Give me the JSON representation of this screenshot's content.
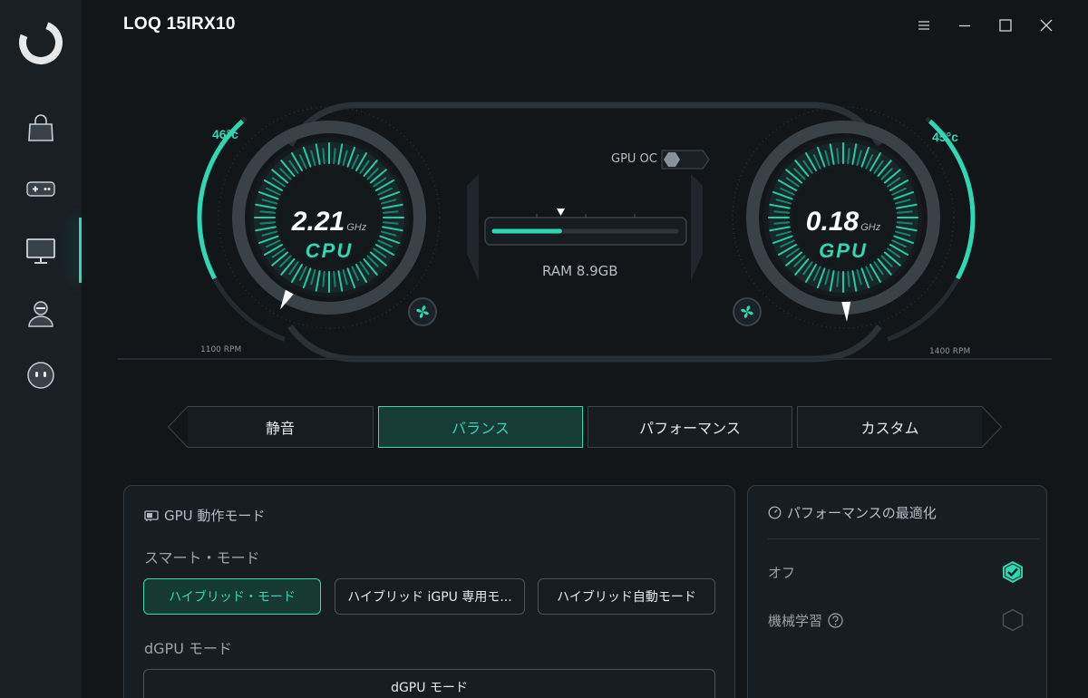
{
  "app": {
    "title": "LOQ 15IRX10"
  },
  "colors": {
    "accent": "#2fd8b3",
    "background": "#121619",
    "sidebar": "#1a1f24"
  },
  "sidebar": {
    "items": [
      {
        "icon": "shopping-bag-icon"
      },
      {
        "icon": "gamepad-icon"
      },
      {
        "icon": "monitor-icon",
        "active": true
      },
      {
        "icon": "user-icon"
      },
      {
        "icon": "robot-face-icon"
      }
    ]
  },
  "dashboard": {
    "cpu": {
      "temp": "46°c",
      "value": "2.21",
      "unit": "GHz",
      "label": "CPU",
      "fan_rpm": "1100 RPM"
    },
    "gpu": {
      "temp": "45°c",
      "value": "0.18",
      "unit": "GHz",
      "label": "GPU",
      "fan_rpm": "1400 RPM"
    },
    "gpu_oc_label": "GPU OC",
    "ram_label": "RAM 8.9GB",
    "ram_fill_fraction": 0.36
  },
  "modes": {
    "tabs": [
      "静音",
      "バランス",
      "パフォーマンス",
      "カスタム"
    ],
    "active_index": 1
  },
  "gpu_panel": {
    "title": "GPU 動作モード",
    "smart_mode_label": "スマート・モード",
    "smart_buttons": [
      "ハイブリッド・モード",
      "ハイブリッド iGPU 専用モ...",
      "ハイブリッド自動モード"
    ],
    "smart_active_index": 0,
    "dgpu_label": "dGPU モード",
    "dgpu_button": "dGPU モード"
  },
  "perf_panel": {
    "title": "パフォーマンスの最適化",
    "options": [
      {
        "label": "オフ",
        "checked": true
      },
      {
        "label": "機械学習",
        "checked": false
      }
    ]
  }
}
